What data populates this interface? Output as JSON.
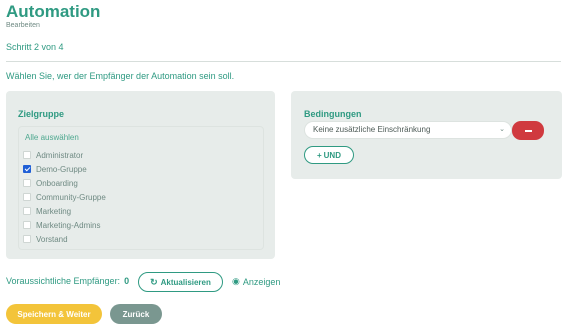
{
  "header": {
    "title": "Automation",
    "subtitle": "Bearbeiten",
    "step": "Schritt 2 von 4",
    "intro": "Wählen Sie, wer der Empfänger der Automation sein soll."
  },
  "target_group": {
    "heading": "Zielgruppe",
    "select_all": "Alle auswählen",
    "options": [
      {
        "label": "Administrator",
        "checked": false
      },
      {
        "label": "Demo-Gruppe",
        "checked": true
      },
      {
        "label": "Onboarding",
        "checked": false
      },
      {
        "label": "Community-Gruppe",
        "checked": false
      },
      {
        "label": "Marketing",
        "checked": false
      },
      {
        "label": "Marketing-Admins",
        "checked": false
      },
      {
        "label": "Vorstand",
        "checked": false
      }
    ]
  },
  "conditions": {
    "heading": "Bedingungen",
    "select_value": "Keine zusätzliche Einschränkung",
    "and_label": "UND"
  },
  "recipients": {
    "label": "Voraussichtliche Empfänger:",
    "count": "0",
    "refresh_label": "Aktualisieren",
    "show_label": "Anzeigen"
  },
  "footer": {
    "save_label": "Speichern & Weiter",
    "back_label": "Zurück"
  },
  "colors": {
    "primary": "#2f9a82",
    "danger": "#d03a3f",
    "warning": "#f3c43a",
    "secondary": "#7a9790",
    "panel": "#e7ecea"
  },
  "icons": {
    "remove": "minus-icon",
    "add": "plus-icon",
    "refresh": "refresh-icon",
    "show": "eye-icon",
    "select": "chevron-down-icon"
  }
}
